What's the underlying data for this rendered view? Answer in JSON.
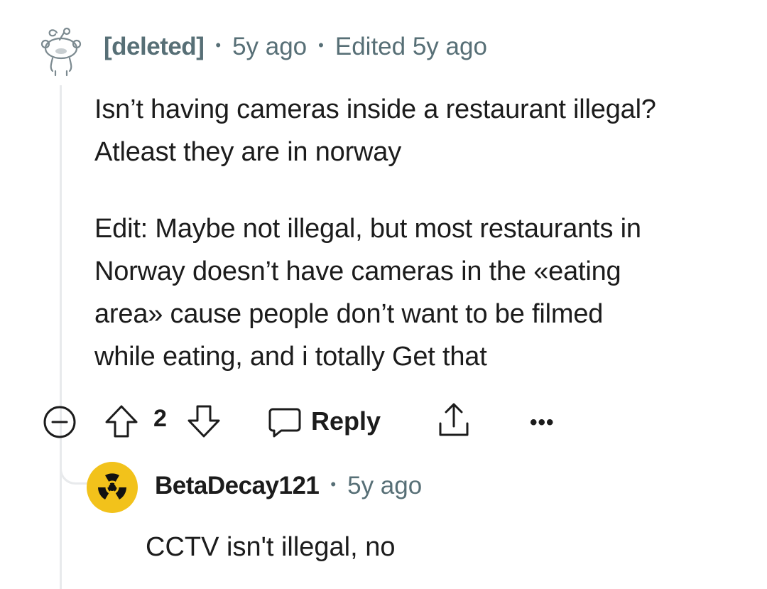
{
  "comment": {
    "author": "[deleted]",
    "age": "5y ago",
    "edited": "Edited 5y ago",
    "paragraphs": [
      "Isn’t having cameras inside a restaurant illegal?\nAtleast they are in norway",
      "Edit: Maybe not illegal, but most restaurants in\nNorway doesn’t have cameras in the «eating\narea» cause people don’t want to be filmed\nwhile eating, and i totally Get that"
    ],
    "score": "2",
    "reply_label": "Reply",
    "more_label": "•••"
  },
  "reply": {
    "author": "BetaDecay121",
    "age": "5y ago",
    "text": "CCTV isn't illegal, no"
  },
  "icons": {
    "deleted_avatar": "snoo-outline-icon",
    "reply_avatar": "radiation-icon",
    "collapse": "minus-circle-icon",
    "upvote": "arrow-up-icon",
    "downvote": "arrow-down-icon",
    "reply": "speech-bubble-icon",
    "share": "share-icon",
    "more": "ellipsis-icon"
  },
  "colors": {
    "meta_text": "#576f76",
    "thread_line": "#e8eaec",
    "radiation_yellow": "#f2c21b"
  }
}
